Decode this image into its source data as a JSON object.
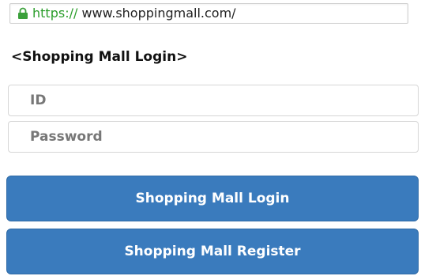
{
  "browser": {
    "url_scheme": "https",
    "url_separator": "://",
    "url_rest": " www.shoppingmall.com/",
    "lock_icon": "lock-icon"
  },
  "login": {
    "title": "<Shopping Mall Login>",
    "id_placeholder": "ID",
    "password_placeholder": "Password",
    "login_button": "Shopping Mall Login",
    "register_button": "Shopping Mall Register"
  },
  "colors": {
    "button_bg": "#3a7bbd",
    "button_text": "#ffffff",
    "secure_green": "#2a9d2a"
  }
}
